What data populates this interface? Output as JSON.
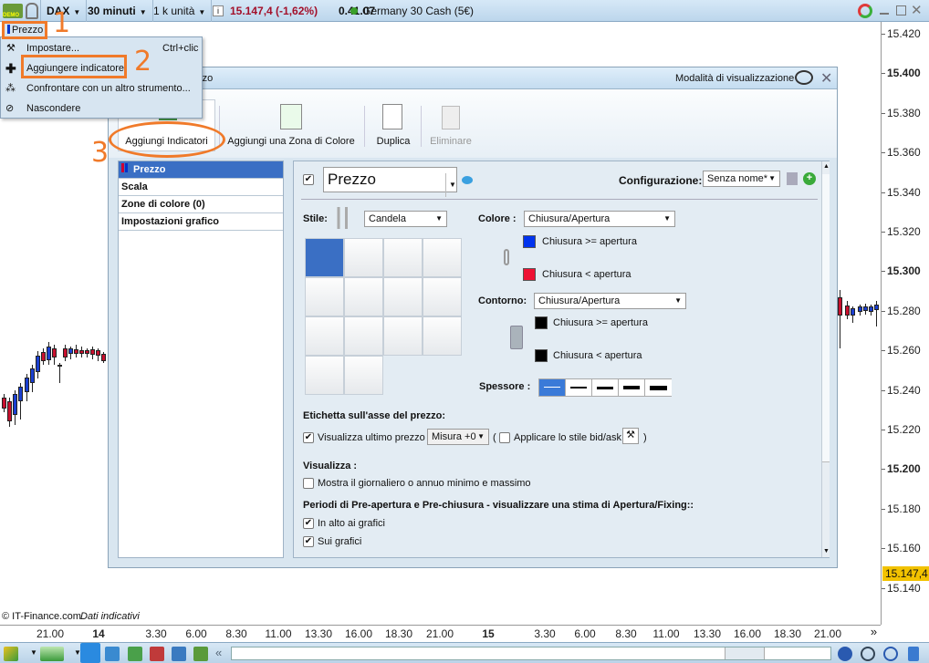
{
  "topbar": {
    "symbol": "DAX",
    "timeframe": "30 minuti",
    "units": "1 k unità",
    "price": "15.147,4 (-1,62%)",
    "time": "0.41.07",
    "instrument": "Germany 30 Cash (5€)",
    "demo": "DEMO"
  },
  "chart": {
    "price_tag": "Prezzo",
    "copyright": "© IT-Finance.com",
    "indicative": "Dati indicativi",
    "last_price": "15.147,4",
    "price_labels": [
      {
        "v": "15.420",
        "b": false
      },
      {
        "v": "15.400",
        "b": true
      },
      {
        "v": "15.380",
        "b": false
      },
      {
        "v": "15.360",
        "b": false
      },
      {
        "v": "15.340",
        "b": false
      },
      {
        "v": "15.320",
        "b": false
      },
      {
        "v": "15.300",
        "b": true
      },
      {
        "v": "15.280",
        "b": false
      },
      {
        "v": "15.260",
        "b": false
      },
      {
        "v": "15.240",
        "b": false
      },
      {
        "v": "15.220",
        "b": false
      },
      {
        "v": "15.200",
        "b": true
      },
      {
        "v": "15.180",
        "b": false
      },
      {
        "v": "15.160",
        "b": false
      },
      {
        "v": "15.140",
        "b": false
      }
    ],
    "time_labels": [
      "21.00",
      "14",
      "3.30",
      "6.00",
      "8.30",
      "11.00",
      "13.30",
      "16.00",
      "18.30",
      "21.00",
      "15",
      "3.30",
      "6.00",
      "8.30",
      "11.00",
      "13.30",
      "16.00",
      "18.30",
      "21.00"
    ],
    "more": "»",
    "scroll_left": "«"
  },
  "menu": {
    "items": [
      {
        "label": "Impostare...",
        "shortcut": "Ctrl+clic"
      },
      {
        "label": "Aggiungere indicatore."
      },
      {
        "label": "Confrontare con un altro strumento..."
      },
      {
        "label": "Nascondere"
      }
    ]
  },
  "annotations": [
    "1",
    "2",
    "3"
  ],
  "dialog": {
    "title": "Prezzo",
    "view_mode": "Modalità di visualizzazione",
    "toolbar": {
      "add_indicator": "Aggiungi Indicatori",
      "add_zone": "Aggiungi una Zona di Colore",
      "duplicate": "Duplica",
      "delete": "Eliminare"
    },
    "list": [
      "Prezzo",
      "Scala",
      "Zone di colore (0)",
      "Impostazioni grafico"
    ],
    "panel": {
      "name": "Prezzo",
      "config_label": "Configurazione:",
      "config_value": "Senza nome*",
      "style_label": "Stile:",
      "style_value": "Candela",
      "color_label": "Colore :",
      "color_value": "Chiusura/Apertura",
      "up": "Chiusura >= apertura",
      "down": "Chiusura < apertura",
      "up_color": "#0033ee",
      "down_color": "#ee1133",
      "outline_label": "Contorno:",
      "outline_value": "Chiusura/Apertura",
      "outline_color": "#000000",
      "thickness_label": "Spessore :",
      "axis_label_title": "Etichetta sull'asse del prezzo:",
      "show_last": "Visualizza ultimo prezzo",
      "size_value": "Misura +0",
      "paren_open": "(",
      "apply_bidask": "Applicare lo stile bid/ask",
      "paren_close": ")",
      "show_title": "Visualizza :",
      "show_minmax": "Mostra il giornaliero o annuo minimo e massimo",
      "pre_title": "Periodi di Pre-apertura e Pre-chiusura - visualizzare una stima di Apertura/Fixing::",
      "top_charts": "In alto ai grafici",
      "on_charts": "Sui grafici"
    }
  }
}
